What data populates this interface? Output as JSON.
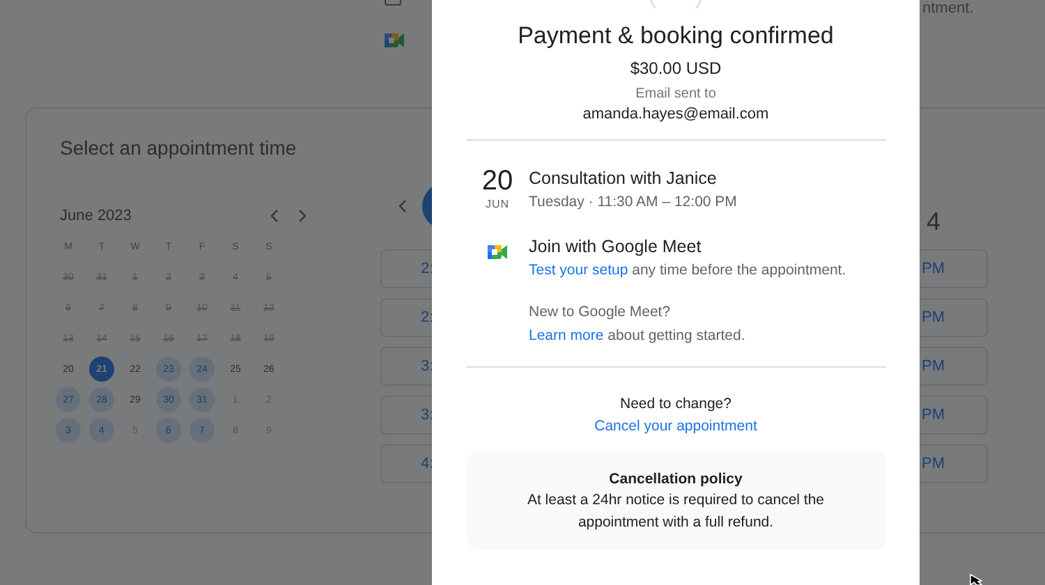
{
  "background": {
    "top_right_text": "ntment.",
    "booking": {
      "title": "Select an appointment time",
      "month": "June 2023",
      "weekdays": [
        "M",
        "T",
        "W",
        "T",
        "F",
        "S",
        "S"
      ],
      "days": [
        {
          "label": "30",
          "kind": "past",
          "selected": false
        },
        {
          "label": "31",
          "kind": "past",
          "selected": false
        },
        {
          "label": "1",
          "kind": "past",
          "selected": false
        },
        {
          "label": "2",
          "kind": "past",
          "selected": false
        },
        {
          "label": "3",
          "kind": "past",
          "selected": false
        },
        {
          "label": "4",
          "kind": "past",
          "selected": false
        },
        {
          "label": "5",
          "kind": "past",
          "selected": false
        },
        {
          "label": "6",
          "kind": "past",
          "selected": false
        },
        {
          "label": "7",
          "kind": "past",
          "selected": false
        },
        {
          "label": "8",
          "kind": "past",
          "selected": false
        },
        {
          "label": "9",
          "kind": "past",
          "selected": false
        },
        {
          "label": "10",
          "kind": "past",
          "selected": false
        },
        {
          "label": "11",
          "kind": "past",
          "selected": false
        },
        {
          "label": "12",
          "kind": "past",
          "selected": false
        },
        {
          "label": "13",
          "kind": "past",
          "selected": false
        },
        {
          "label": "14",
          "kind": "past",
          "selected": false
        },
        {
          "label": "15",
          "kind": "past",
          "selected": false
        },
        {
          "label": "16",
          "kind": "past",
          "selected": false
        },
        {
          "label": "17",
          "kind": "past",
          "selected": false
        },
        {
          "label": "18",
          "kind": "past",
          "selected": false
        },
        {
          "label": "19",
          "kind": "past",
          "selected": false
        },
        {
          "label": "20",
          "kind": "plain",
          "selected": false
        },
        {
          "label": "21",
          "kind": "available",
          "selected": true
        },
        {
          "label": "22",
          "kind": "plain",
          "selected": false
        },
        {
          "label": "23",
          "kind": "available",
          "selected": false
        },
        {
          "label": "24",
          "kind": "available",
          "selected": false
        },
        {
          "label": "25",
          "kind": "plain",
          "selected": false
        },
        {
          "label": "26",
          "kind": "plain",
          "selected": false
        },
        {
          "label": "27",
          "kind": "available",
          "selected": false
        },
        {
          "label": "28",
          "kind": "available",
          "selected": false
        },
        {
          "label": "29",
          "kind": "plain",
          "selected": false
        },
        {
          "label": "30",
          "kind": "available",
          "selected": false
        },
        {
          "label": "31",
          "kind": "available",
          "selected": false
        },
        {
          "label": "1",
          "kind": "other",
          "selected": false
        },
        {
          "label": "2",
          "kind": "other",
          "selected": false
        },
        {
          "label": "3",
          "kind": "available",
          "selected": false
        },
        {
          "label": "4",
          "kind": "available",
          "selected": false
        },
        {
          "label": "5",
          "kind": "other",
          "selected": false
        },
        {
          "label": "6",
          "kind": "available",
          "selected": false
        },
        {
          "label": "7",
          "kind": "available",
          "selected": false
        },
        {
          "label": "8",
          "kind": "other",
          "selected": false
        },
        {
          "label": "9",
          "kind": "other",
          "selected": false
        }
      ],
      "slot_day": "4",
      "slots": [
        {
          "start": "2:",
          "end": "PM"
        },
        {
          "start": "2:",
          "end": "PM"
        },
        {
          "start": "3:",
          "end": "PM"
        },
        {
          "start": "3:",
          "end": "PM"
        },
        {
          "start": "4:",
          "end": "PM"
        }
      ]
    }
  },
  "modal": {
    "title": "Payment & booking confirmed",
    "price": "$30.00 USD",
    "email_label": "Email sent to",
    "email": "amanda.hayes@email.com",
    "event": {
      "day": "20",
      "month": "JUN",
      "title": "Consultation with Janice",
      "when": "Tuesday · 11:30 AM – 12:00 PM"
    },
    "meet": {
      "title": "Join with Google Meet",
      "setup_link": "Test your setup",
      "setup_rest": "any time before the appointment.",
      "new_text": "New to Google Meet?",
      "learn_link": "Learn more",
      "learn_rest": "about getting started."
    },
    "change": {
      "question": "Need to change?",
      "link": "Cancel your appointment"
    },
    "policy": {
      "title": "Cancellation policy",
      "text": "At least a 24hr notice is required to cancel the appointment with a full refund."
    }
  }
}
